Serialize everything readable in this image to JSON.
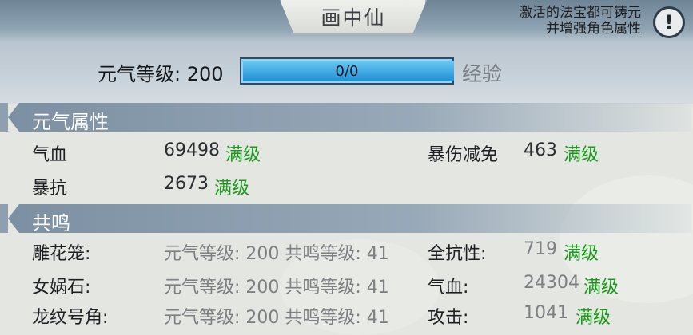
{
  "header": {
    "title": "画中仙",
    "tip_line1": "激活的法宝都可铸元",
    "tip_line2": "并增强角色属性",
    "info_icon": "!"
  },
  "level": {
    "label": "元气等级: 200",
    "exp_text": "0/0",
    "exp_progress": 0,
    "exp_label": "经验"
  },
  "yuanqi": {
    "title": "元气属性",
    "rows": [
      {
        "label": "气血",
        "value": "69498",
        "status": "满级"
      },
      {
        "label": "暴伤减免",
        "value": "463",
        "status": "满级"
      },
      {
        "label": "暴抗",
        "value": "2673",
        "status": "满级"
      }
    ]
  },
  "gongming": {
    "title": "共鸣",
    "rows": [
      {
        "name": "雕花笼:",
        "req": "元气等级: 200 共鸣等级: 41",
        "attr": "全抗性:",
        "value": "719",
        "status": "满级"
      },
      {
        "name": "女娲石:",
        "req": "元气等级: 200 共鸣等级: 41",
        "attr": "气血:",
        "value": "24304",
        "status": "满级"
      },
      {
        "name": "龙纹号角:",
        "req": "元气等级: 200 共鸣等级: 41",
        "attr": "攻击:",
        "value": "1041",
        "status": "满级"
      }
    ]
  },
  "colors": {
    "accent_green": "#1a9a1a",
    "header_blue": "#7c90a3",
    "exp_bar": "#1f8fd4"
  }
}
